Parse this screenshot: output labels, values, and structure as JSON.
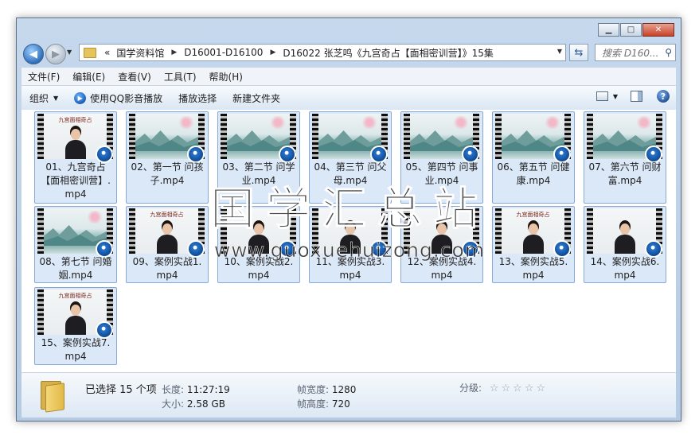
{
  "address": {
    "crumbs": [
      "国学资料馆",
      "D16001-D16100",
      "D16022 张芝鸣《九宫奇占【面相密训营】》15集"
    ],
    "lead": "«"
  },
  "search": {
    "placeholder": "搜索 D160..."
  },
  "menu": [
    "文件(F)",
    "编辑(E)",
    "查看(V)",
    "工具(T)",
    "帮助(H)"
  ],
  "toolbar": {
    "organize": "组织",
    "play_qq": "使用QQ影音播放",
    "play_select": "播放选择",
    "new_folder": "新建文件夹"
  },
  "files": [
    {
      "name": "01、九宫奇占【面相密训营】.mp4",
      "thumb": "studio",
      "title": "九宫面相奇占"
    },
    {
      "name": "02、第一节 问孩子.mp4",
      "thumb": "landscape"
    },
    {
      "name": "03、第二节 问学业.mp4",
      "thumb": "landscape"
    },
    {
      "name": "04、第三节 问父母.mp4",
      "thumb": "landscape"
    },
    {
      "name": "05、第四节 问事业.mp4",
      "thumb": "landscape"
    },
    {
      "name": "06、第五节 问健康.mp4",
      "thumb": "landscape"
    },
    {
      "name": "07、第六节 问财富.mp4",
      "thumb": "landscape"
    },
    {
      "name": "08、第七节 问婚姻.mp4",
      "thumb": "landscape"
    },
    {
      "name": "09、案例实战1.mp4",
      "thumb": "studio",
      "title": "九宫面相奇占"
    },
    {
      "name": "10、案例实战2.mp4",
      "thumb": "studio",
      "title": ""
    },
    {
      "name": "11、案例实战3.mp4",
      "thumb": "studio",
      "title": ""
    },
    {
      "name": "12、案例实战4.mp4",
      "thumb": "studio",
      "title": ""
    },
    {
      "name": "13、案例实战5.mp4",
      "thumb": "studio",
      "title": "九宫面相奇占"
    },
    {
      "name": "14、案例实战6.mp4",
      "thumb": "studio",
      "title": ""
    },
    {
      "name": "15、案例实战7.mp4",
      "thumb": "studio",
      "title": "九宫面相奇占"
    }
  ],
  "details": {
    "selected": "已选择 15 个项",
    "length_label": "长度:",
    "length_value": "11:27:19",
    "size_label": "大小:",
    "size_value": "2.58 GB",
    "width_label": "帧宽度:",
    "width_value": "1280",
    "height_label": "帧高度:",
    "height_value": "720",
    "rating_label": "分级:",
    "rating_stars": "☆☆☆☆☆"
  },
  "watermark": {
    "cn": "国学汇总站",
    "url": "www.guoxuehuizong.com"
  },
  "colors": {
    "selection_bg": "#dbe8f8",
    "selection_border": "#87a9d3",
    "frame": "#b5cbe4"
  }
}
